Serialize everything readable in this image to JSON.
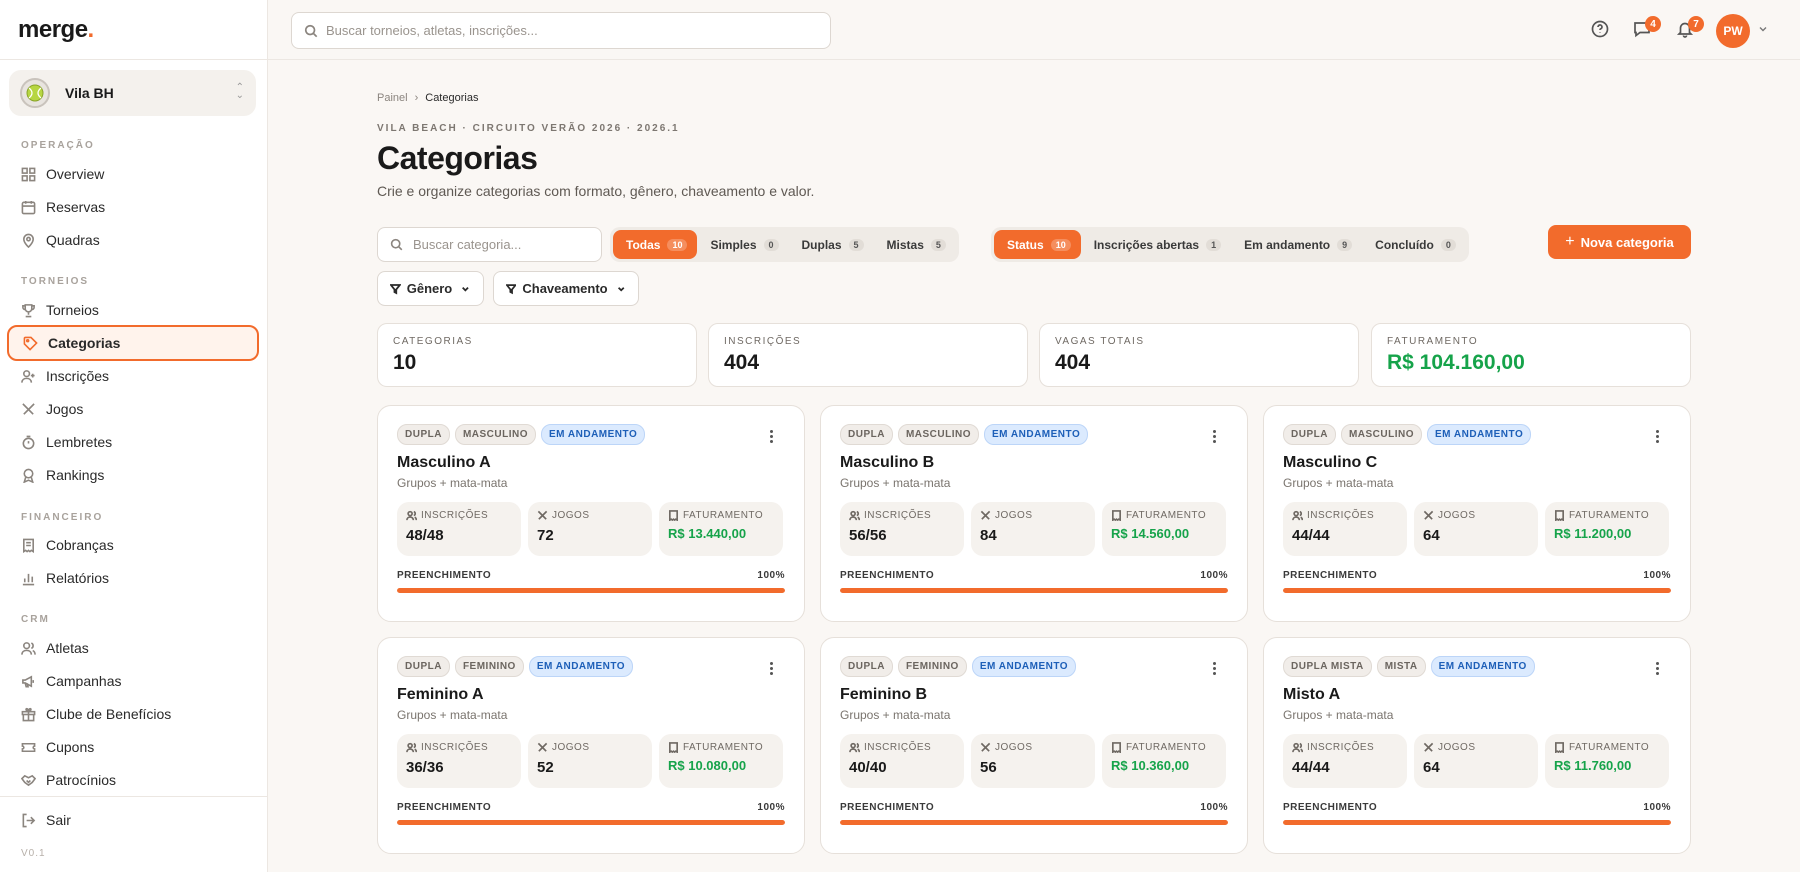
{
  "brand": {
    "name": "merge",
    "dot": "."
  },
  "org": {
    "name": "Vila BH"
  },
  "nav": {
    "sections": [
      "OPERAÇÃO",
      "TORNEIOS",
      "FINANCEIRO",
      "CRM"
    ],
    "operacao": [
      "Overview",
      "Reservas",
      "Quadras"
    ],
    "torneios": [
      "Torneios",
      "Categorias",
      "Inscrições",
      "Jogos",
      "Lembretes",
      "Rankings"
    ],
    "financeiro": [
      "Cobranças",
      "Relatórios"
    ],
    "crm": [
      "Atletas",
      "Campanhas",
      "Clube de Benefícios",
      "Cupons",
      "Patrocínios"
    ],
    "logout": "Sair",
    "version": "V0.1"
  },
  "topbar": {
    "search_placeholder": "Buscar torneios, atletas, inscrições...",
    "messages_count": "4",
    "notifications_count": "7",
    "user_initials": "PW"
  },
  "page": {
    "breadcrumb_root": "Painel",
    "breadcrumb_current": "Categorias",
    "eyebrow": "VILA BEACH · CIRCUITO VERÃO 2026 · 2026.1",
    "title": "Categorias",
    "subtitle": "Crie e organize categorias com formato, gênero, chaveamento e valor."
  },
  "filters": {
    "search_placeholder": "Buscar categoria...",
    "type": [
      {
        "label": "Todas",
        "count": "10"
      },
      {
        "label": "Simples",
        "count": "0"
      },
      {
        "label": "Duplas",
        "count": "5"
      },
      {
        "label": "Mistas",
        "count": "5"
      }
    ],
    "status": [
      {
        "label": "Status",
        "count": "10"
      },
      {
        "label": "Inscrições abertas",
        "count": "1"
      },
      {
        "label": "Em andamento",
        "count": "9"
      },
      {
        "label": "Concluído",
        "count": "0"
      }
    ],
    "gender_label": "Gênero",
    "bracket_label": "Chaveamento",
    "new_button": "Nova categoria"
  },
  "stats": [
    {
      "label": "CATEGORIAS",
      "value": "10"
    },
    {
      "label": "INSCRIÇÕES",
      "value": "404"
    },
    {
      "label": "VAGAS TOTAIS",
      "value": "404"
    },
    {
      "label": "FATURAMENTO",
      "value": "R$ 104.160,00"
    }
  ],
  "metric_labels": {
    "inscricoes": "INSCRIÇÕES",
    "jogos": "JOGOS",
    "faturamento": "FATURAMENTO",
    "preenchimento": "PREENCHIMENTO"
  },
  "cards": [
    {
      "tags": [
        "DUPLA",
        "MASCULINO",
        "EM ANDAMENTO"
      ],
      "title": "Masculino A",
      "format": "Grupos + mata-mata",
      "inscricoes": "48/48",
      "jogos": "72",
      "faturamento": "R$ 13.440,00",
      "fill_pct": "100%",
      "fill": 1.0
    },
    {
      "tags": [
        "DUPLA",
        "MASCULINO",
        "EM ANDAMENTO"
      ],
      "title": "Masculino B",
      "format": "Grupos + mata-mata",
      "inscricoes": "56/56",
      "jogos": "84",
      "faturamento": "R$ 14.560,00",
      "fill_pct": "100%",
      "fill": 1.0
    },
    {
      "tags": [
        "DUPLA",
        "MASCULINO",
        "EM ANDAMENTO"
      ],
      "title": "Masculino C",
      "format": "Grupos + mata-mata",
      "inscricoes": "44/44",
      "jogos": "64",
      "faturamento": "R$ 11.200,00",
      "fill_pct": "100%",
      "fill": 1.0
    },
    {
      "tags": [
        "DUPLA",
        "FEMININO",
        "EM ANDAMENTO"
      ],
      "title": "Feminino A",
      "format": "Grupos + mata-mata",
      "inscricoes": "36/36",
      "jogos": "52",
      "faturamento": "R$ 10.080,00",
      "fill_pct": "100%",
      "fill": 1.0
    },
    {
      "tags": [
        "DUPLA",
        "FEMININO",
        "EM ANDAMENTO"
      ],
      "title": "Feminino B",
      "format": "Grupos + mata-mata",
      "inscricoes": "40/40",
      "jogos": "56",
      "faturamento": "R$ 10.360,00",
      "fill_pct": "100%",
      "fill": 1.0
    },
    {
      "tags": [
        "DUPLA MISTA",
        "MISTA",
        "EM ANDAMENTO"
      ],
      "title": "Misto A",
      "format": "Grupos + mata-mata",
      "inscricoes": "44/44",
      "jogos": "64",
      "faturamento": "R$ 11.760,00",
      "fill_pct": "100%",
      "fill": 1.0
    }
  ],
  "colors": {
    "accent": "#f26b2c",
    "money": "#16a34a",
    "status_blue": "#1d5fb8"
  }
}
